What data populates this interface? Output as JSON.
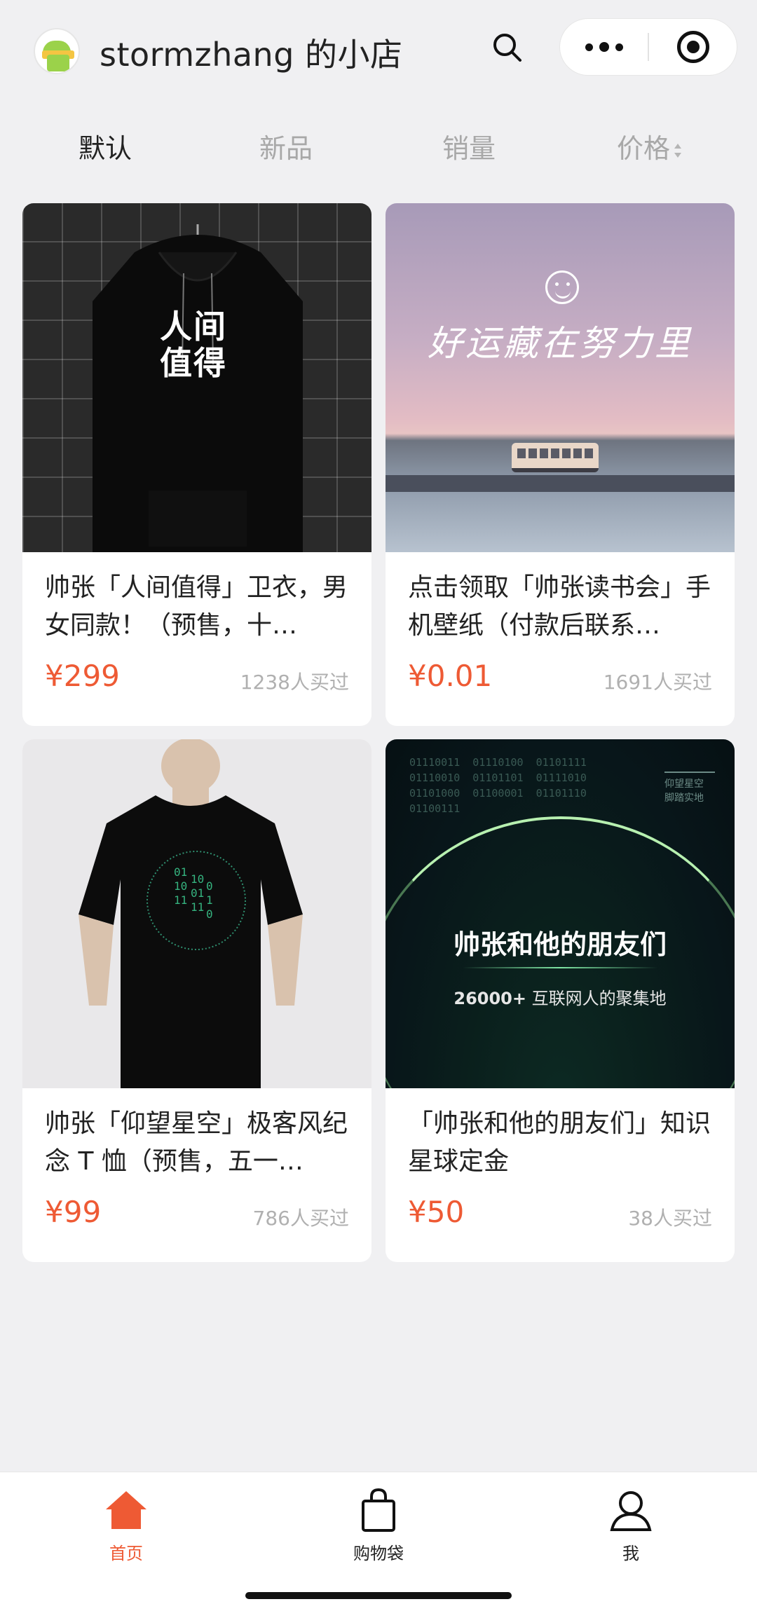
{
  "header": {
    "shop_title": "stormzhang 的小店",
    "search_icon": "search-icon",
    "more_icon": "more-dots-icon",
    "close_icon": "close-miniprogram-icon"
  },
  "tabs": [
    {
      "label": "默认",
      "active": true
    },
    {
      "label": "新品",
      "active": false
    },
    {
      "label": "销量",
      "active": false
    },
    {
      "label": "价格",
      "active": false
    }
  ],
  "products": [
    {
      "name": "帅张「人间值得」卫衣，男女同款！（预售，十…",
      "price": "¥299",
      "sold": "1238人买过",
      "image_text": "人间值得"
    },
    {
      "name": "点击领取「帅张读书会」手机壁纸（付款后联系…",
      "price": "¥0.01",
      "sold": "1691人买过",
      "image_text": "好运藏在努力里"
    },
    {
      "name": "帅张「仰望星空」极客风纪念 T 恤（预售，五一…",
      "price": "¥99",
      "sold": "786人买过",
      "image_text": ""
    },
    {
      "name": "「帅张和他的朋友们」知识星球定金",
      "price": "¥50",
      "sold": "38人买过",
      "image_text": "帅张和他的朋友们",
      "image_sub_num": "26000+",
      "image_sub_text": "互联网人的聚集地",
      "image_tag": "仰望星空 脚踏实地",
      "image_binary": "01110011  01110100  01101111\n01110010  01101101  01111010\n01101000  01100001  01101110\n01100111"
    }
  ],
  "bottom_nav": [
    {
      "label": "首页",
      "icon": "home-icon",
      "active": true
    },
    {
      "label": "购物袋",
      "icon": "shopping-bag-icon",
      "active": false
    },
    {
      "label": "我",
      "icon": "person-icon",
      "active": false
    }
  ],
  "colors": {
    "accent": "#ee5a34",
    "background": "#f0f0f2",
    "card": "#ffffff",
    "muted": "#b0b0b0"
  }
}
